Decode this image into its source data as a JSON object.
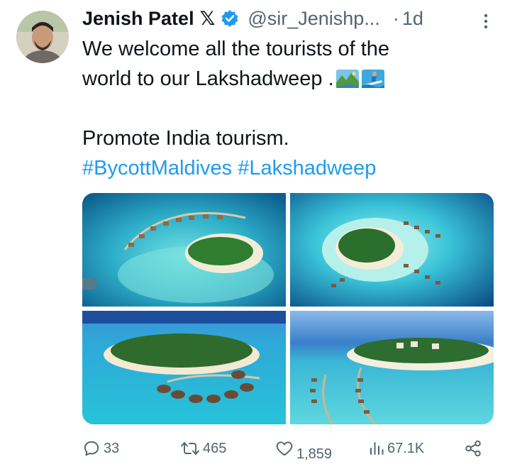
{
  "author": {
    "name": "Jenish Patel",
    "badge": "𝕏",
    "handle": "@sir_Jenishp...",
    "separator": "·",
    "time": "1d"
  },
  "tweet": {
    "line1": "We welcome all the tourists of the",
    "line2": "world to our Lakshadweep .",
    "line3": "Promote India tourism.",
    "hashtags": [
      "#BycottMaldives",
      "#Lakshadweep"
    ]
  },
  "icons": {
    "verified": "verified-badge-icon",
    "more": "more-vertical-icon",
    "reply": "reply-icon",
    "retweet": "retweet-icon",
    "like": "like-icon",
    "views": "views-icon",
    "share": "share-icon",
    "emoji1": "national-park-emoji",
    "emoji2": "person-surfing-emoji"
  },
  "media": {
    "photos": [
      "island-resort-photo-1",
      "island-resort-photo-2",
      "island-resort-photo-3",
      "island-resort-photo-4"
    ]
  },
  "stats": {
    "replies": "33",
    "retweets": "465",
    "likes": "1,859",
    "views": "67.1K"
  },
  "colors": {
    "accent": "#1d9bf0",
    "text": "#0f1419",
    "secondary": "#536471"
  }
}
